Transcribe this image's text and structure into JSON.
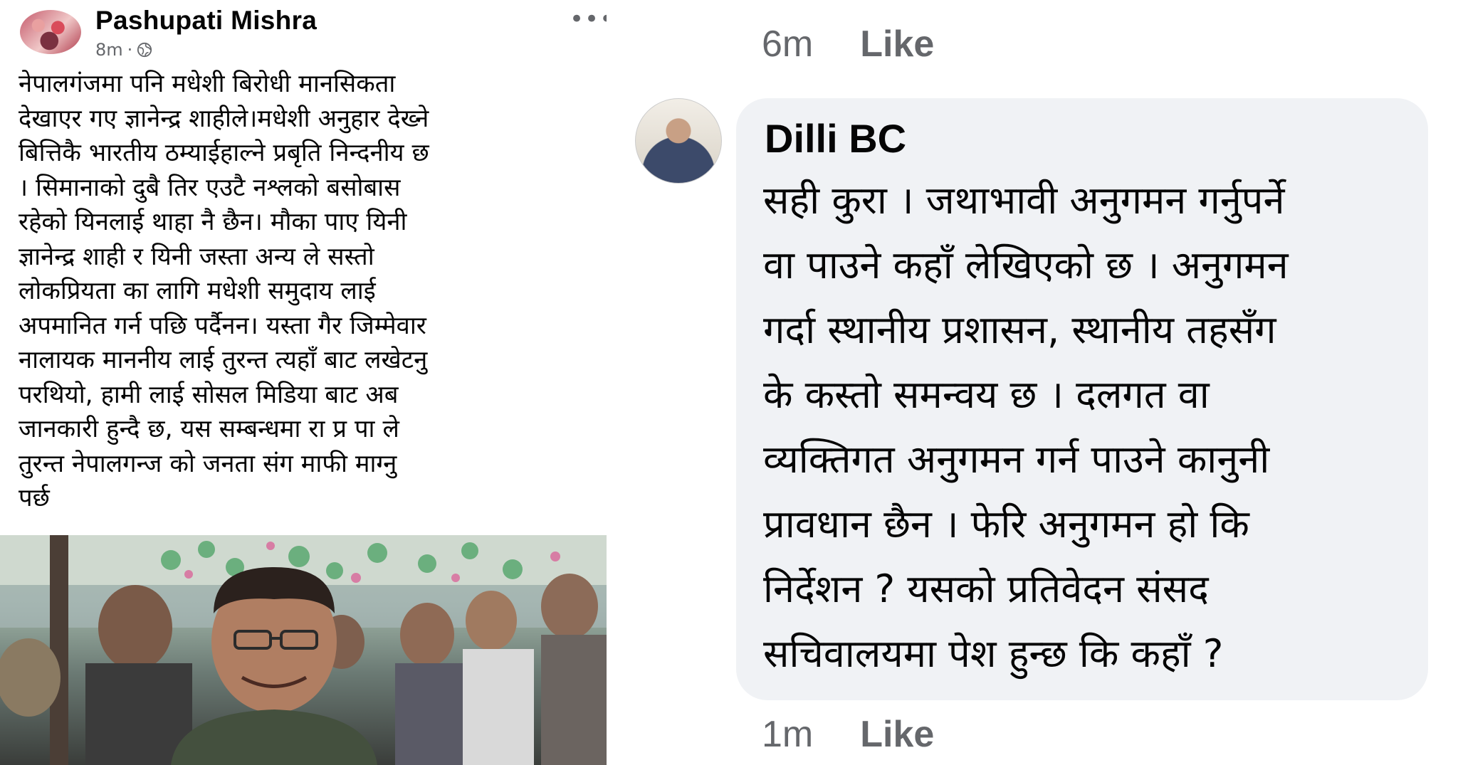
{
  "post": {
    "author": "Pashupati Mishra",
    "time": "8m",
    "separator": "·",
    "privacy_icon": "globe-icon",
    "more_icon": "more-options-icon",
    "text": "नेपालगंजमा पनि मधेशी बिरोधी मानसिकता\nदेखाएर गए ज्ञानेन्द्र शाहीले।मधेशी अनुहार देख्ने\nबित्तिकै भारतीय ठम्याईहाल्ने प्रबृति निन्दनीय छ\n। सिमानाको दुबै तिर एउटै नश्लको बसोबास\nरहेको यिनलाई थाहा नै छैन। मौका पाए यिनी\nज्ञानेन्द्र शाही र यिनी जस्ता अन्य ले सस्तो\nलोकप्रियता का लागि मधेशी समुदाय लाई\nअपमानित गर्न पछि पर्दैनन। यस्ता गैर जिम्मेवार\nनालायक माननीय लाई तुरन्त त्यहाँ बाट लखेटनु\nपरथियो, हामी लाई सोसल मिडिया बाट अब\nजानकारी हुन्दै छ, यस सम्बन्धमा रा प्र पा ले\nतुरन्त नेपालगन्ज को जनता संग माफी माग्नु\nपर्छ"
  },
  "comment_top": {
    "time": "6m",
    "like_label": "Like"
  },
  "comment": {
    "author": "Dilli BC",
    "text": "सही कुरा । जथाभावी अनुगमन गर्नुपर्ने\nवा पाउने कहाँ लेखिएको छ । अनुगमन\nगर्दा स्थानीय प्रशासन, स्थानीय तहसँग\nके कस्तो समन्वय छ । दलगत वा\nव्यक्तिगत अनुगमन गर्न पाउने कानुनी\nप्रावधान छैन । फेरि अनुगमन हो कि\nनिर्देशन ? यसको प्रतिवेदन संसद\nसचिवालयमा पेश हुन्छ कि कहाँ ?",
    "time": "1m",
    "like_label": "Like"
  }
}
